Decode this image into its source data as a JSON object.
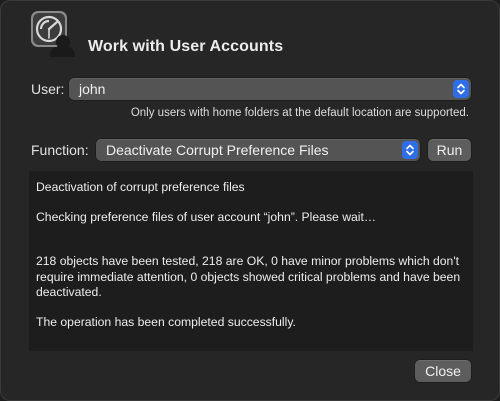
{
  "window": {
    "title": "Work with User Accounts",
    "icon": "user-accounts-app-icon"
  },
  "user": {
    "label": "User:",
    "selected": "john",
    "note": "Only users with home folders at the default location are supported."
  },
  "function": {
    "label": "Function:",
    "selected": "Deactivate Corrupt Preference Files",
    "run_label": "Run"
  },
  "log": {
    "lines": [
      "Deactivation of corrupt preference files",
      "Checking preference files of user account “john”. Please wait…",
      "218 objects have been tested, 218 are OK, 0 have minor problems which don't require immediate attention, 0 objects showed critical problems and have been deactivated.",
      "The operation has been completed successfully."
    ]
  },
  "footer": {
    "close_label": "Close"
  },
  "colors": {
    "window_bg": "#262626",
    "accent": "#2f6ee6",
    "control_bg": "#545454",
    "log_bg": "#1d1d1d"
  }
}
